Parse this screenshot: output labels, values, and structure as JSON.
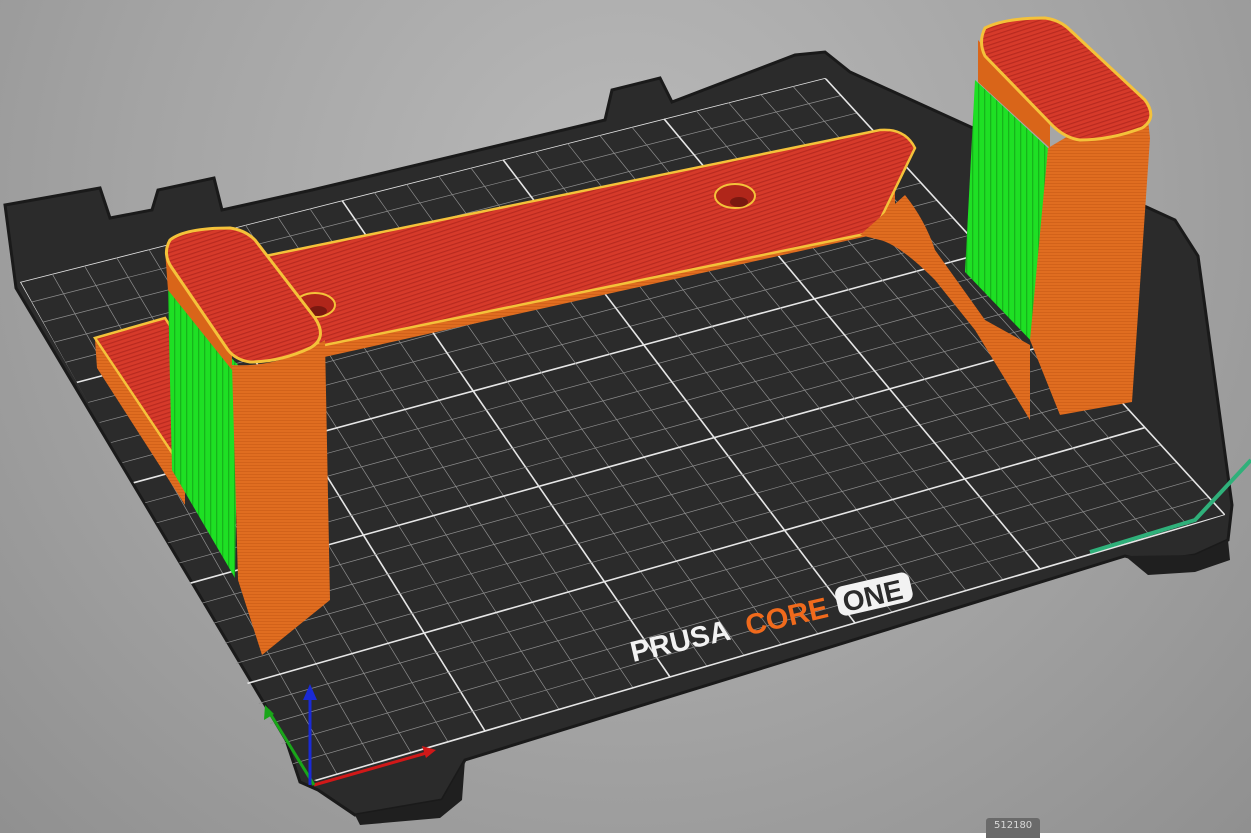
{
  "app": {
    "view": "3D preview"
  },
  "bed": {
    "brand_prusa": "PRUSA",
    "brand_core": "CORE",
    "brand_one": "ONE",
    "colors": {
      "plate": "#2c2c2c",
      "plate_edge": "#1b1b1b",
      "grid_minor": "#8e8e8e",
      "grid_major": "#e6e6e6",
      "logo_text": "#f2f2f2",
      "logo_accent": "#f06a1c"
    }
  },
  "model": {
    "name": "bracket-with-two-posts",
    "colors": {
      "perimeter": "#e06d20",
      "top_solid_infill": "#d63a2a",
      "edge_highlight": "#f4c23a",
      "support_material": "#1ee024"
    }
  },
  "axes": {
    "x_color": "#d01818",
    "y_color": "#19a619",
    "z_color": "#1a2ad6"
  },
  "status": {
    "corner_label": "512180"
  }
}
